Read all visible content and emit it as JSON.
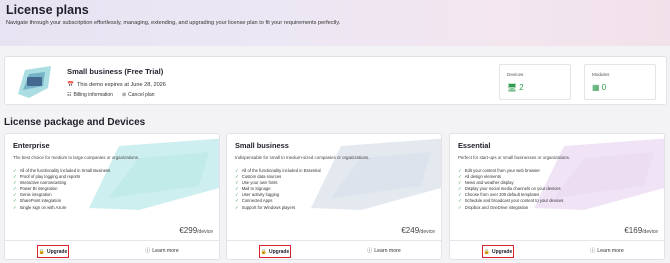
{
  "header": {
    "title": "License plans",
    "subtitle": "Navigate through your subscription effortlessly, managing, extending, and upgrading your license plan to fit your requirements perfectly."
  },
  "current_plan": {
    "name": "Small business (Free Trial)",
    "expires": "This demo expires at June 28, 2026",
    "billing_label": "Billing information",
    "cancel_label": "Cancel plan",
    "devices": {
      "label": "Devices",
      "value": "2"
    },
    "modules": {
      "label": "Modules",
      "value": "0"
    }
  },
  "section_title": "License package and Devices",
  "plans": [
    {
      "name": "Enterprise",
      "description": "The best choice for medium to large companies or organizations.",
      "features": [
        "All of the functionality included in Small Business",
        "Proof of play logging and reports",
        "Interactive narrowcasting",
        "Power BI integration",
        "Genie integration",
        "SharePoint integration",
        "Single sign on with Azure"
      ],
      "price": "€299",
      "unit": "/device",
      "upgrade_label": "Upgrade",
      "learn_label": "Learn more",
      "accent": "#7fd8d4"
    },
    {
      "name": "Small business",
      "description": "Indispensable for small to medium-sized companies or organizations.",
      "features": [
        "All of the functionality included in Essential",
        "Custom data sources",
        "Use your own fonts",
        "Mail to Signage",
        "User activity logging",
        "Connected Apps",
        "Support for Windows players"
      ],
      "price": "€249",
      "unit": "/device",
      "upgrade_label": "Upgrade",
      "learn_label": "Learn more",
      "accent": "#b9c4d6"
    },
    {
      "name": "Essential",
      "description": "Perfect for start-ups or small businesses or organizations.",
      "features": [
        "Edit your content from your web browser",
        "All design elements",
        "News and weather display",
        "Display your social media channels on your devices",
        "Choose from over 200 default templates",
        "Schedule and broadcast your content to your devices",
        "Dropbox and OneDrive integration"
      ],
      "price": "€169",
      "unit": "/device",
      "upgrade_label": "Upgrade",
      "learn_label": "Learn more",
      "accent": "#d6b6e4"
    }
  ],
  "colors": {
    "highlight_border": "#d9232e",
    "check": "#2e9b4e",
    "stat_value": "#2e9b4e"
  }
}
